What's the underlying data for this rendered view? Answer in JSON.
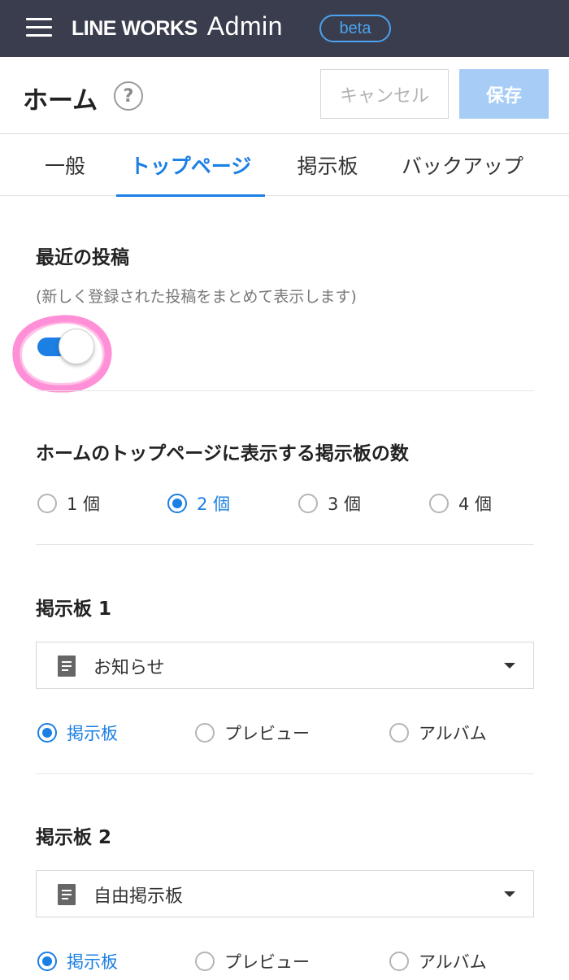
{
  "topbar": {
    "brand": "LINE WORKS",
    "brand_sub": "Admin",
    "badge": "beta"
  },
  "header": {
    "title": "ホーム",
    "help": "?",
    "cancel_label": "キャンセル",
    "save_label": "保存"
  },
  "tabs": [
    {
      "label": "一般",
      "active": false
    },
    {
      "label": "トップページ",
      "active": true
    },
    {
      "label": "掲示板",
      "active": false
    },
    {
      "label": "バックアップ",
      "active": false
    }
  ],
  "recent_posts": {
    "title": "最近の投稿",
    "description": "(新しく登録された投稿をまとめて表示します)",
    "enabled": true
  },
  "board_count": {
    "title": "ホームのトップページに表示する掲示板の数",
    "options": [
      "1 個",
      "2 個",
      "3 個",
      "4 個"
    ],
    "selected": "2 個"
  },
  "board1": {
    "title": "掲示板 1",
    "select_value": "お知らせ",
    "options": [
      "掲示板",
      "プレビュー",
      "アルバム"
    ],
    "selected": "掲示板"
  },
  "board2": {
    "title": "掲示板 2",
    "select_value": "自由掲示板",
    "options": [
      "掲示板",
      "プレビュー",
      "アルバム"
    ],
    "selected": "掲示板"
  },
  "colors": {
    "topbar": "#3a3d4d",
    "accent": "#1b7fe3",
    "save_button": "#a7cdf7",
    "highlight": "#ff69c8"
  }
}
